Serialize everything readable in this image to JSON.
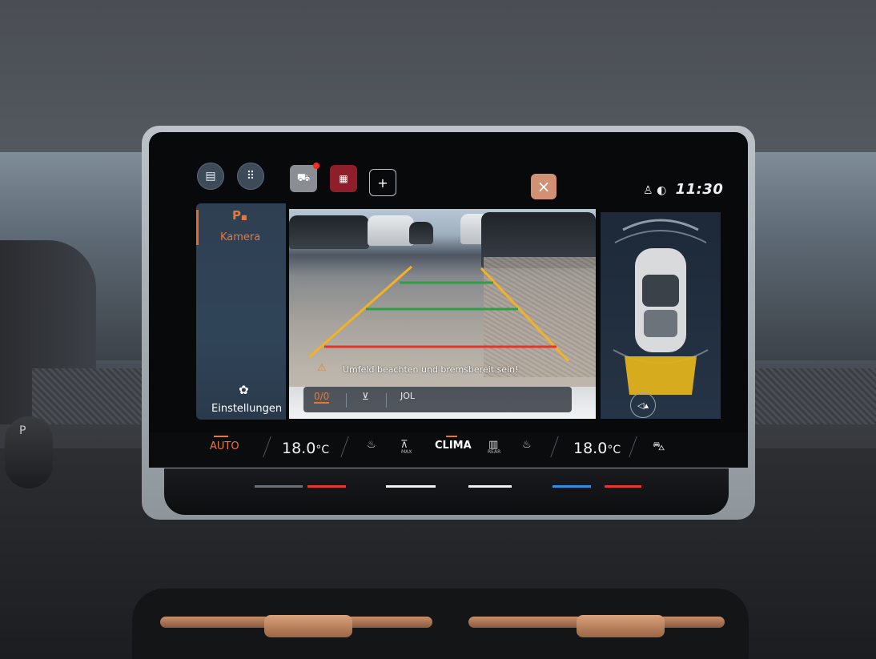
{
  "topbar": {
    "add_label": "+",
    "close_label": "×",
    "time": "11:30"
  },
  "sidebar": {
    "camera_glyph": "P",
    "camera_label": "Kamera",
    "settings_label": "Einstellungen"
  },
  "camera": {
    "warning": "Umfeld beachten und bremsbereit sein!",
    "toolbar": [
      "0/0",
      "⊻",
      "JOL"
    ]
  },
  "climate": {
    "mode": "AUTO",
    "left_temp": "18.0",
    "right_temp": "18.0",
    "unit": "°C",
    "clima_label": "CLIMA",
    "max_label": "MAX",
    "rear_label": "REAR"
  },
  "colors": {
    "accent": "#e8773a",
    "guide_near": "#e53526",
    "guide_mid": "#2ea043",
    "guide_side": "#f4b223",
    "sensor_zone": "#e0b21c"
  }
}
